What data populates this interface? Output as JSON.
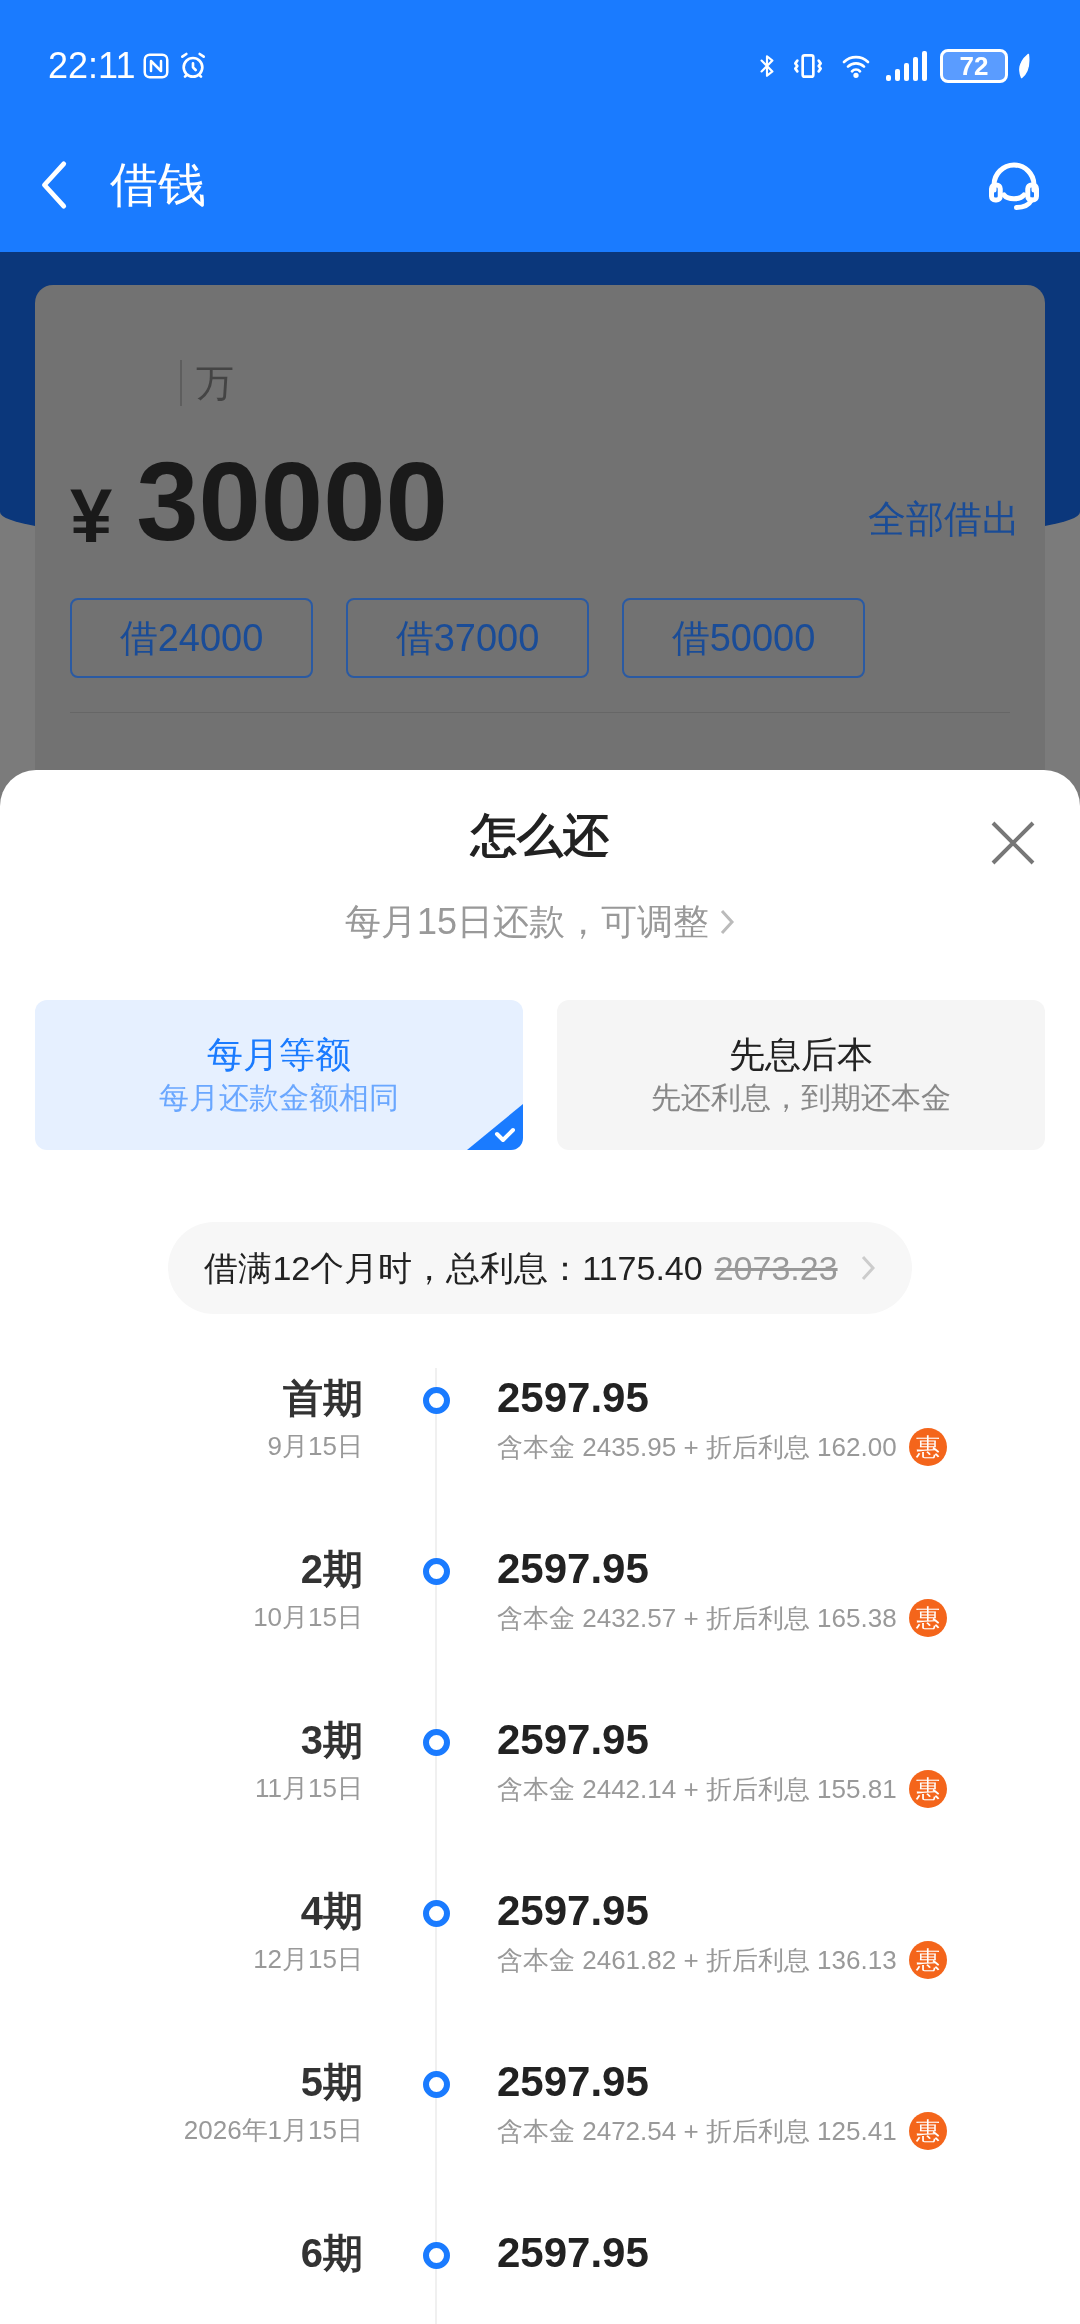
{
  "status_bar": {
    "time": "22:11",
    "battery": "72"
  },
  "header": {
    "title": "借钱"
  },
  "loan_card": {
    "unit": "万",
    "currency": "¥",
    "amount": "30000",
    "max_link": "全部借出",
    "quick_amounts": [
      "借24000",
      "借37000",
      "借50000"
    ]
  },
  "sheet": {
    "title": "怎么还",
    "due_day": "每月15日还款，可调整",
    "plans": [
      {
        "name": "每月等额",
        "desc": "每月还款金额相同",
        "selected": true
      },
      {
        "name": "先息后本",
        "desc": "先还利息，到期还本金",
        "selected": false
      }
    ],
    "summary": {
      "label": "借满12个月时，总利息：",
      "interest": "1175.40",
      "original": "2073.23"
    },
    "schedule": [
      {
        "period": "首期",
        "date": "9月15日",
        "amount": "2597.95",
        "detail": "含本金 2435.95 + 折后利息 162.00",
        "badge": "惠"
      },
      {
        "period": "2期",
        "date": "10月15日",
        "amount": "2597.95",
        "detail": "含本金 2432.57 + 折后利息 165.38",
        "badge": "惠"
      },
      {
        "period": "3期",
        "date": "11月15日",
        "amount": "2597.95",
        "detail": "含本金 2442.14 + 折后利息 155.81",
        "badge": "惠"
      },
      {
        "period": "4期",
        "date": "12月15日",
        "amount": "2597.95",
        "detail": "含本金 2461.82 + 折后利息 136.13",
        "badge": "惠"
      },
      {
        "period": "5期",
        "date": "2026年1月15日",
        "amount": "2597.95",
        "detail": "含本金 2472.54 + 折后利息 125.41",
        "badge": "惠"
      },
      {
        "period": "6期",
        "amount": "2597.95"
      }
    ]
  }
}
